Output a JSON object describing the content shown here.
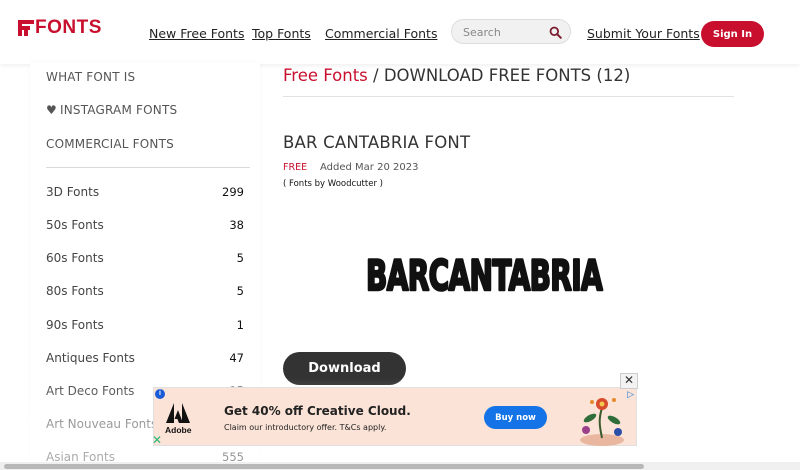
{
  "header": {
    "logo_text": "FONTS",
    "nav": [
      "New Free Fonts",
      "Top Fonts",
      "Commercial Fonts"
    ],
    "search_placeholder": "Search",
    "submit_label": "Submit Your Fonts",
    "signin_label": "Sign In",
    "brand_color": "#c8102e"
  },
  "sidebar": {
    "links": [
      "WHAT FONT IS",
      "INSTAGRAM FONTS",
      "COMMERCIAL FONTS"
    ],
    "categories": [
      {
        "name": "3D Fonts",
        "count": "299"
      },
      {
        "name": "50s Fonts",
        "count": "38"
      },
      {
        "name": "60s Fonts",
        "count": "5"
      },
      {
        "name": "80s Fonts",
        "count": "5"
      },
      {
        "name": "90s Fonts",
        "count": "1"
      },
      {
        "name": "Antiques Fonts",
        "count": "47"
      },
      {
        "name": "Art Deco Fonts",
        "count": "35"
      },
      {
        "name": "Art Nouveau Fonts",
        "count": ""
      },
      {
        "name": "Asian Fonts",
        "count": "555"
      }
    ]
  },
  "main": {
    "crumb_link": "Free Fonts",
    "crumb_rest": " / DOWNLOAD FREE FONTS (12)",
    "font_title": "BAR CANTABRIA FONT",
    "free_label": "FREE",
    "added": "Added Mar 20 2023",
    "byline": "( Fonts by Woodcutter )",
    "preview_text": "BARCANTABRIA",
    "download_label": "Download"
  },
  "ad": {
    "logo_text": "Adobe",
    "headline": "Get 40% off Creative Cloud.",
    "sub": "Claim our introductory offer. T&Cs apply.",
    "button": "Buy now",
    "close": "✕",
    "accent": "#1473e6"
  }
}
